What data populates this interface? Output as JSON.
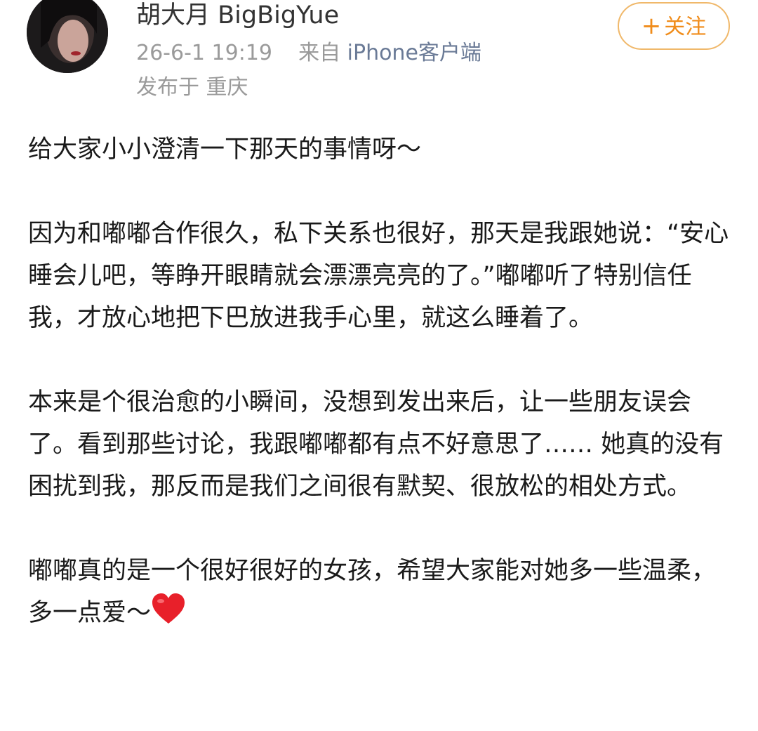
{
  "author": {
    "name": "胡大月 BigBigYue",
    "avatar_icon": "user-avatar"
  },
  "meta": {
    "timestamp": "26-6-1 19:19",
    "source_prefix": "来自",
    "source_app": "iPhone客户端",
    "location": "发布于 重庆"
  },
  "follow": {
    "plus": "+",
    "label": "关注"
  },
  "post": {
    "paragraphs": [
      "给大家小小澄清一下那天的事情呀～",
      "因为和嘟嘟合作很久，私下关系也很好，那天是我跟她说：“安心睡会儿吧，等睁开眼睛就会漂漂亮亮的了。”嘟嘟听了特别信任我，才放心地把下巴放进我手心里，就这么睡着了。",
      "本来是个很治愈的小瞬间，没想到发出来后，让一些朋友误会了。看到那些讨论，我跟嘟嘟都有点不好意思了…… 她真的没有困扰到我，那反而是我们之间很有默契、很放松的相处方式。",
      "嘟嘟真的是一个很好很好的女孩，希望大家能对她多一些温柔，多一点爱～"
    ],
    "heart_icon": "red-heart-icon"
  },
  "colors": {
    "follow_accent": "#f08c1a",
    "follow_border": "#f0b86a",
    "meta_gray": "#9a9a9a",
    "source_link": "#6a7a96",
    "heart": "#e8202a"
  }
}
